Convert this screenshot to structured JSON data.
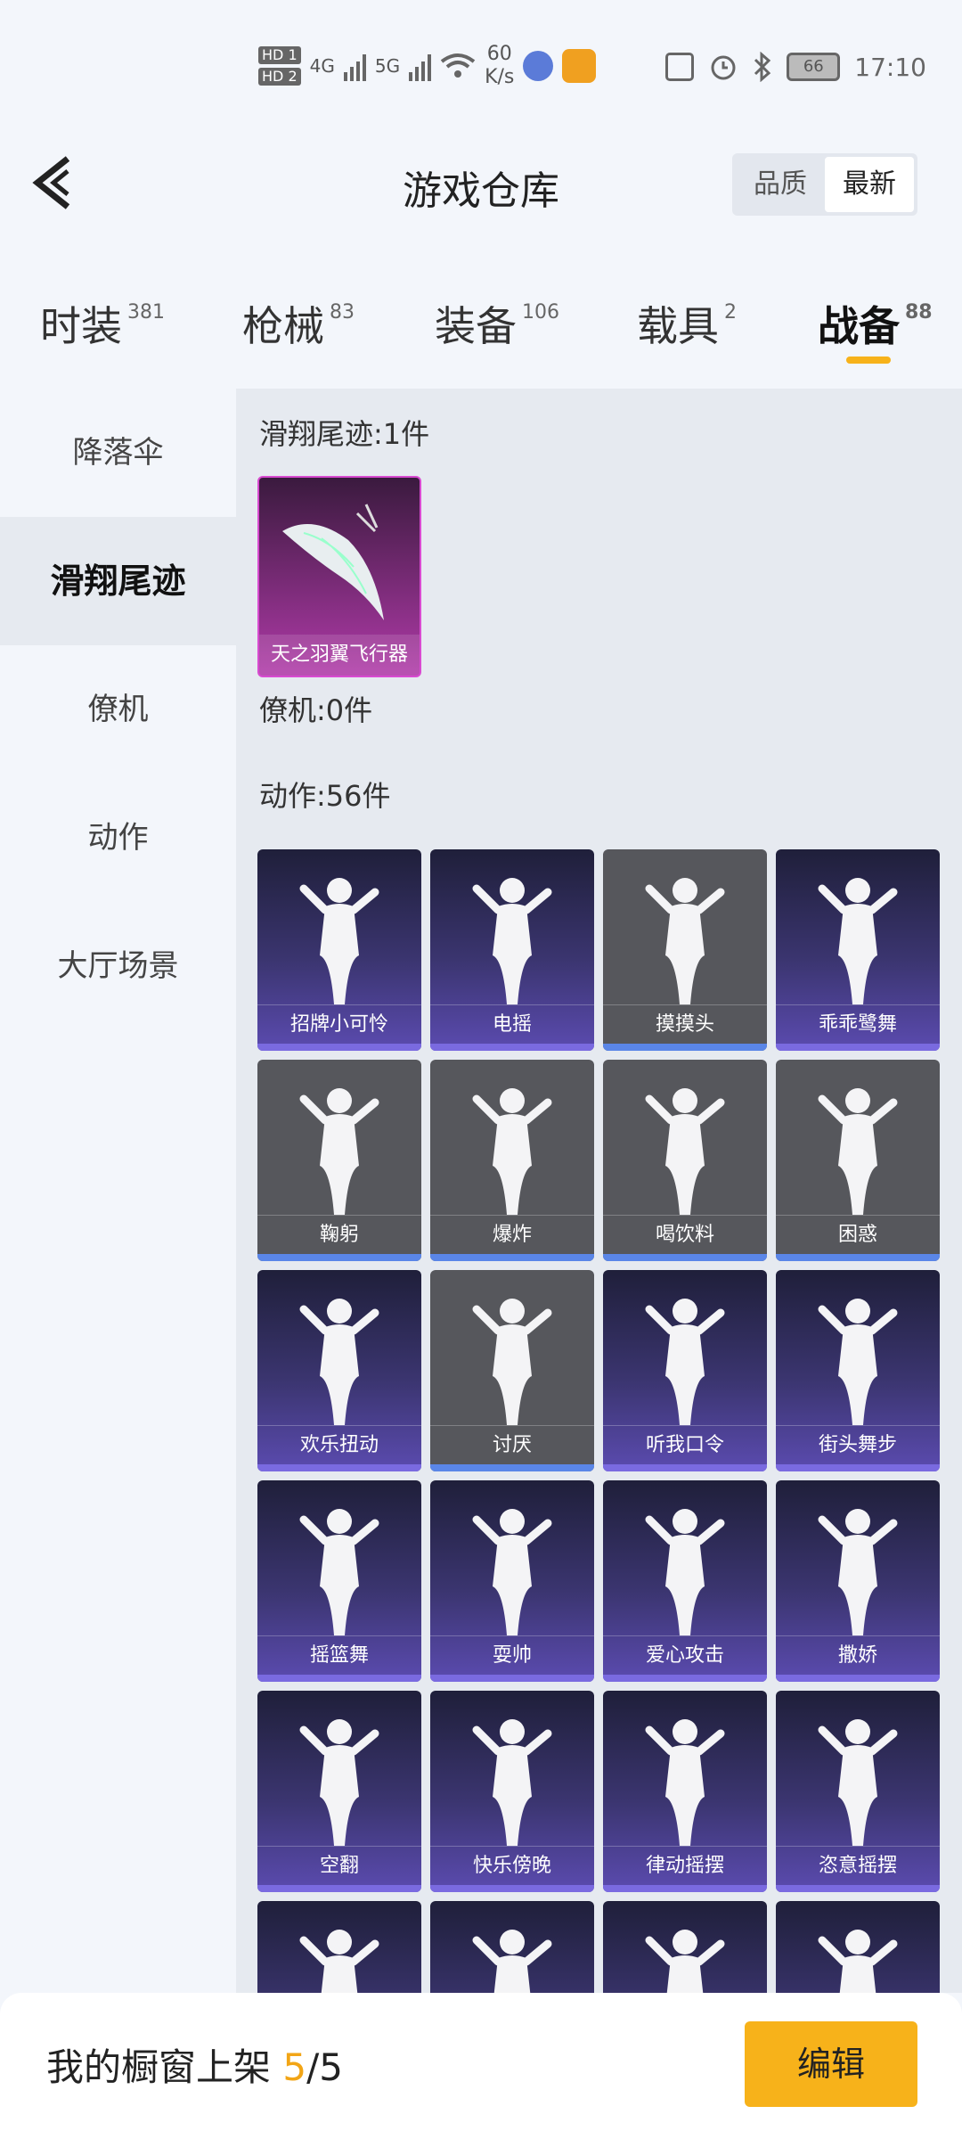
{
  "status_bar": {
    "hd1": "HD 1",
    "hd2": "HD 2",
    "sig1": "4G",
    "sig2": "5G",
    "net_speed_value": "60",
    "net_speed_unit": "K/s",
    "battery": "66",
    "time": "17:10"
  },
  "header": {
    "back_icon": "chevron-left-icon",
    "title": "游戏仓库",
    "sort_quality": "品质",
    "sort_newest": "最新"
  },
  "tabs": [
    {
      "label": "时装",
      "count": "381"
    },
    {
      "label": "枪械",
      "count": "83"
    },
    {
      "label": "装备",
      "count": "106"
    },
    {
      "label": "载具",
      "count": "2"
    },
    {
      "label": "战备",
      "count": "88"
    }
  ],
  "sidebar": {
    "items": [
      {
        "label": "降落伞"
      },
      {
        "label": "滑翔尾迹"
      },
      {
        "label": "僚机"
      },
      {
        "label": "动作"
      },
      {
        "label": "大厅场景"
      }
    ]
  },
  "content": {
    "glide_title": "滑翔尾迹:1件",
    "glide_item": "天之羽翼飞行器",
    "wingman_title": "僚机:0件",
    "action_title": "动作:56件",
    "actions": [
      {
        "label": "招牌小可怜",
        "style": "purple"
      },
      {
        "label": "电摇",
        "style": "purple"
      },
      {
        "label": "摸摸头",
        "style": "gray"
      },
      {
        "label": "乖乖鹭舞",
        "style": "purple"
      },
      {
        "label": "鞠躬",
        "style": "gray"
      },
      {
        "label": "爆炸",
        "style": "gray"
      },
      {
        "label": "喝饮料",
        "style": "gray"
      },
      {
        "label": "困惑",
        "style": "gray"
      },
      {
        "label": "欢乐扭动",
        "style": "purple"
      },
      {
        "label": "讨厌",
        "style": "gray"
      },
      {
        "label": "听我口令",
        "style": "purple"
      },
      {
        "label": "街头舞步",
        "style": "purple"
      },
      {
        "label": "摇篮舞",
        "style": "purple"
      },
      {
        "label": "耍帅",
        "style": "purple"
      },
      {
        "label": "爱心攻击",
        "style": "purple"
      },
      {
        "label": "撒娇",
        "style": "purple"
      },
      {
        "label": "空翻",
        "style": "purple"
      },
      {
        "label": "快乐傍晚",
        "style": "purple"
      },
      {
        "label": "律动摇摆",
        "style": "purple"
      },
      {
        "label": "恣意摇摆",
        "style": "purple"
      },
      {
        "label": "",
        "style": "purple"
      },
      {
        "label": "",
        "style": "purple"
      },
      {
        "label": "",
        "style": "purple"
      },
      {
        "label": "",
        "style": "purple"
      }
    ]
  },
  "bottom": {
    "showcase_label": "我的橱窗上架",
    "showcase_count": "5",
    "showcase_total": "/5",
    "edit_button": "编辑"
  },
  "colors": {
    "accent": "#f7b21a",
    "card_purple": "#3b3570",
    "card_gray": "#56575c"
  }
}
